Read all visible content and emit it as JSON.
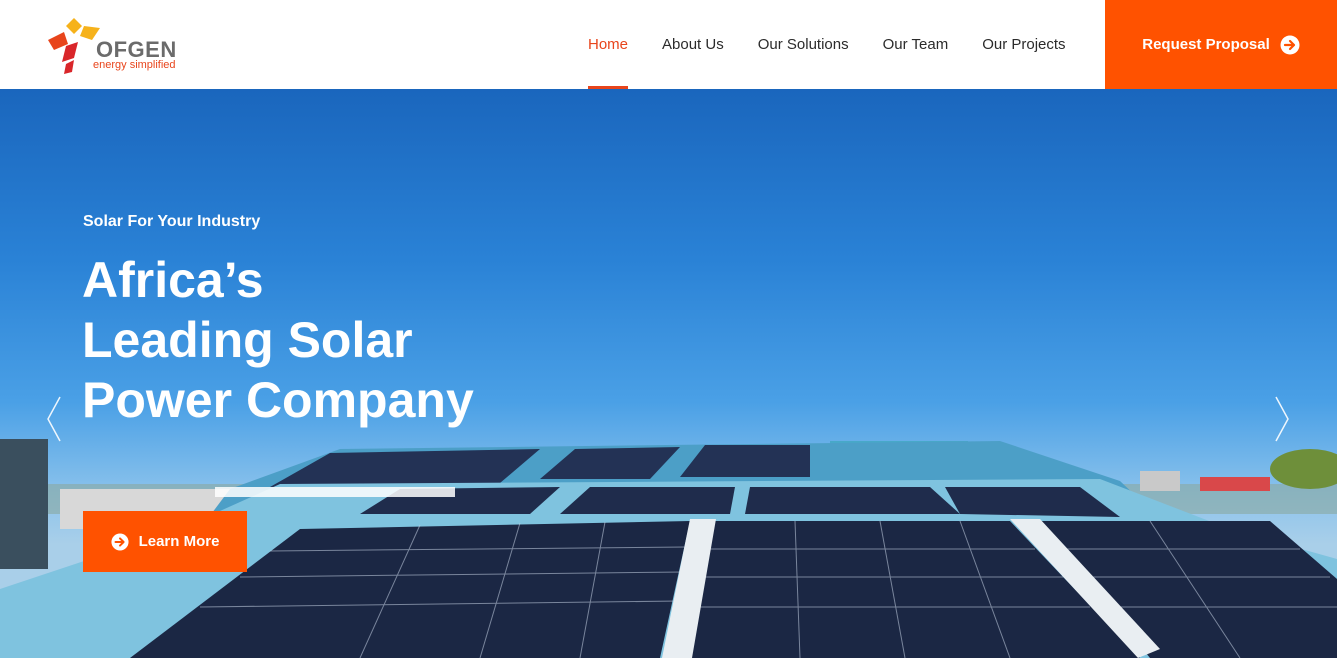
{
  "brand": {
    "name": "OFGEN",
    "tagline": "energy simplified",
    "colors": {
      "orange": "#ff5200",
      "accent": "#e8451c",
      "yellow": "#f6b21b",
      "red": "#d9262a",
      "gray": "#6b6b6b"
    }
  },
  "nav": {
    "items": [
      {
        "label": "Home",
        "active": true
      },
      {
        "label": "About Us",
        "active": false
      },
      {
        "label": "Our Solutions",
        "active": false
      },
      {
        "label": "Our Team",
        "active": false
      },
      {
        "label": "Our Projects",
        "active": false
      }
    ]
  },
  "cta": {
    "label": "Request Proposal",
    "icon": "arrow-circle-right-icon"
  },
  "hero": {
    "eyebrow": "Solar For Your Industry",
    "headline_lines": [
      "Africa’s",
      "Leading Solar",
      "Power Company"
    ],
    "button": {
      "label": "Learn More",
      "icon": "arrow-circle-right-icon"
    },
    "prev_icon": "chevron-left-icon",
    "next_icon": "chevron-right-icon"
  }
}
